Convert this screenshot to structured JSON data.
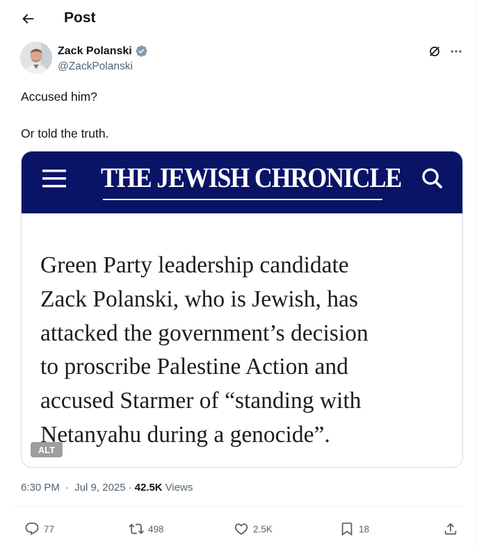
{
  "header": {
    "title": "Post"
  },
  "author": {
    "name": "Zack Polanski",
    "handle": "@ZackPolanski",
    "verified": true,
    "verified_color": "#829aab"
  },
  "post": {
    "paragraphs": [
      "Accused him?",
      "Or told the truth."
    ],
    "media": {
      "masthead": "THE JEWISH CHRONICLE",
      "masthead_color": "#0a1466",
      "article_lines": [
        "Green Party leadership candidate",
        "Zack Polanski, who is Jewish, has",
        "attacked the government’s decision",
        "to proscribe Palestine Action and",
        "accused Starmer of “standing with",
        "Netanyahu during a genocide”."
      ],
      "alt_label": "ALT"
    }
  },
  "meta": {
    "time": "6:30 PM",
    "separator": "·",
    "date": "Jul 9, 2025",
    "views_count": "42.5K",
    "views_label": "Views"
  },
  "actions": {
    "replies": "77",
    "reposts": "498",
    "likes": "2.5K",
    "bookmarks": "18"
  },
  "icons": {
    "back": "arrow-left-icon",
    "verified": "verified-badge-icon",
    "grok": "grok-icon",
    "more": "more-horizontal-icon",
    "menu": "hamburger-menu-icon",
    "search": "search-icon",
    "reply": "reply-icon",
    "repost": "repost-icon",
    "like": "heart-icon",
    "bookmark": "bookmark-icon",
    "share": "share-icon"
  }
}
